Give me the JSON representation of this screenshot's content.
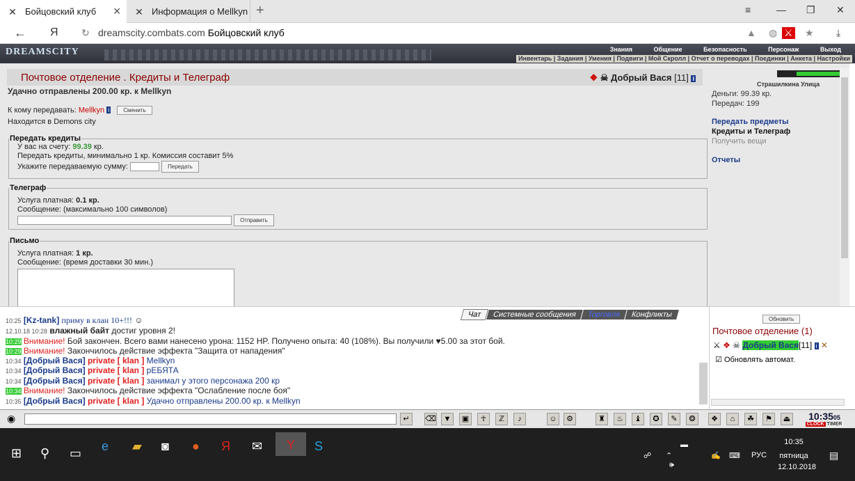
{
  "browser": {
    "tabs": [
      {
        "label": "Бойцовский клуб"
      },
      {
        "label": "Информация о Mellkyn"
      }
    ],
    "address": {
      "domain": "dreamscity.combats.com",
      "title": "Бойцовский клуб"
    },
    "ya_label": "Я"
  },
  "game": {
    "logo": "DREAMSCITY",
    "top_menu": [
      "Знания",
      "Общение",
      "Безопасность",
      "Персонаж",
      "Выход"
    ],
    "sub_menu": "Инвентарь | Задания | Умения | Подвиги | Мой Скролл | Отчет о переводах | Поединки | Анкета | Настройки"
  },
  "main": {
    "header_title": "Почтовое отделение .  Кредиты и Телеграф",
    "user_name": "Добрый Вася",
    "user_level": "[11]",
    "success_msg": "Удачно отправлены 200.00 кр. к Mellkyn",
    "to_label": "К кому передавать:",
    "to_name": "Mellkyn",
    "change_btn": "Сменить",
    "location": "Находится в Demons city",
    "credits": {
      "legend": "Передать кредиты",
      "account_prefix": "У вас на счету:",
      "account_value": "99.39",
      "account_suffix": "кр.",
      "rule": "Передать кредиты, минимально 1 кр. Комиссия составит 5%",
      "amount_label": "Укажите передаваемую сумму:",
      "send_btn": "Передать"
    },
    "telegraph": {
      "legend": "Телеграф",
      "cost_label": "Услуга платная:",
      "cost": "0.1 кр.",
      "msg_label": "Сообщение: (максимально 100 символов)",
      "send_btn": "Отправить"
    },
    "letter": {
      "legend": "Письмо",
      "cost_label": "Услуга платная:",
      "cost": "1 кр.",
      "msg_label": "Сообщение: (время доставки 30 мин.)"
    }
  },
  "side": {
    "location": "Страшилкина Улица",
    "money": "Деньги: 99.39 кр.",
    "transfers": "Передач: 199",
    "link1": "Передать предметы",
    "link2": "Кредиты и Телеграф",
    "link3": "Получить вещи",
    "link4": "Отчеты"
  },
  "chat": {
    "tabs": [
      "Чат",
      "Системные сообщения",
      "Торговля",
      "Конфликты"
    ],
    "lines": [
      {
        "time": "10:25",
        "nick": "[Kz-tank]",
        "text": "приму в клан 10+!!!"
      },
      {
        "time": "12.10.18 10:28",
        "nick": "влажный байт",
        "text": "достиг уровня 2!"
      },
      {
        "time": "10:29",
        "warn": "Внимание!",
        "text": "Бой закончен. Всего вами нанесено урона: 1152 HP. Получено опыта: 40 (108%). Вы получили ♥5.00 за этот бой."
      },
      {
        "time": "10:29",
        "warn": "Внимание!",
        "text": "Закончилось действие эффекта \"Защита от нападения\""
      },
      {
        "time": "10:34",
        "nick": "[Добрый Вася]",
        "prv": "private [ klan ]",
        "text": "Mellkyn"
      },
      {
        "time": "10:34",
        "nick": "[Добрый Вася]",
        "prv": "private [ klan ]",
        "text": "рЕБЯТА"
      },
      {
        "time": "10:34",
        "nick": "[Добрый Вася]",
        "prv": "private [ klan ]",
        "text": "занимал у этого персонажа 200 кр"
      },
      {
        "time": "10:34",
        "warn": "Внимание!",
        "text": "Закончилось действие эффекта \"Ослабление после боя\""
      },
      {
        "time": "10:35",
        "nick": "[Добрый Вася]",
        "prv": "private [ klan ]",
        "text": "Удачно отправлены 200.00 кр. к Mellkyn"
      }
    ]
  },
  "rpanel": {
    "refresh_btn": "Обновить",
    "title": "Почтовое отделение (1)",
    "user": "Добрый Вася",
    "level": "[11]",
    "auto": "Обновлять автомат."
  },
  "toolbar": {
    "clock": "10:35",
    "clock_sec": "05",
    "clock_label": "CLOCK",
    "timer_label": "TIMER"
  },
  "taskbar": {
    "time": "10:35",
    "day": "пятница",
    "date": "12.10.2018",
    "lang": "РУС"
  }
}
